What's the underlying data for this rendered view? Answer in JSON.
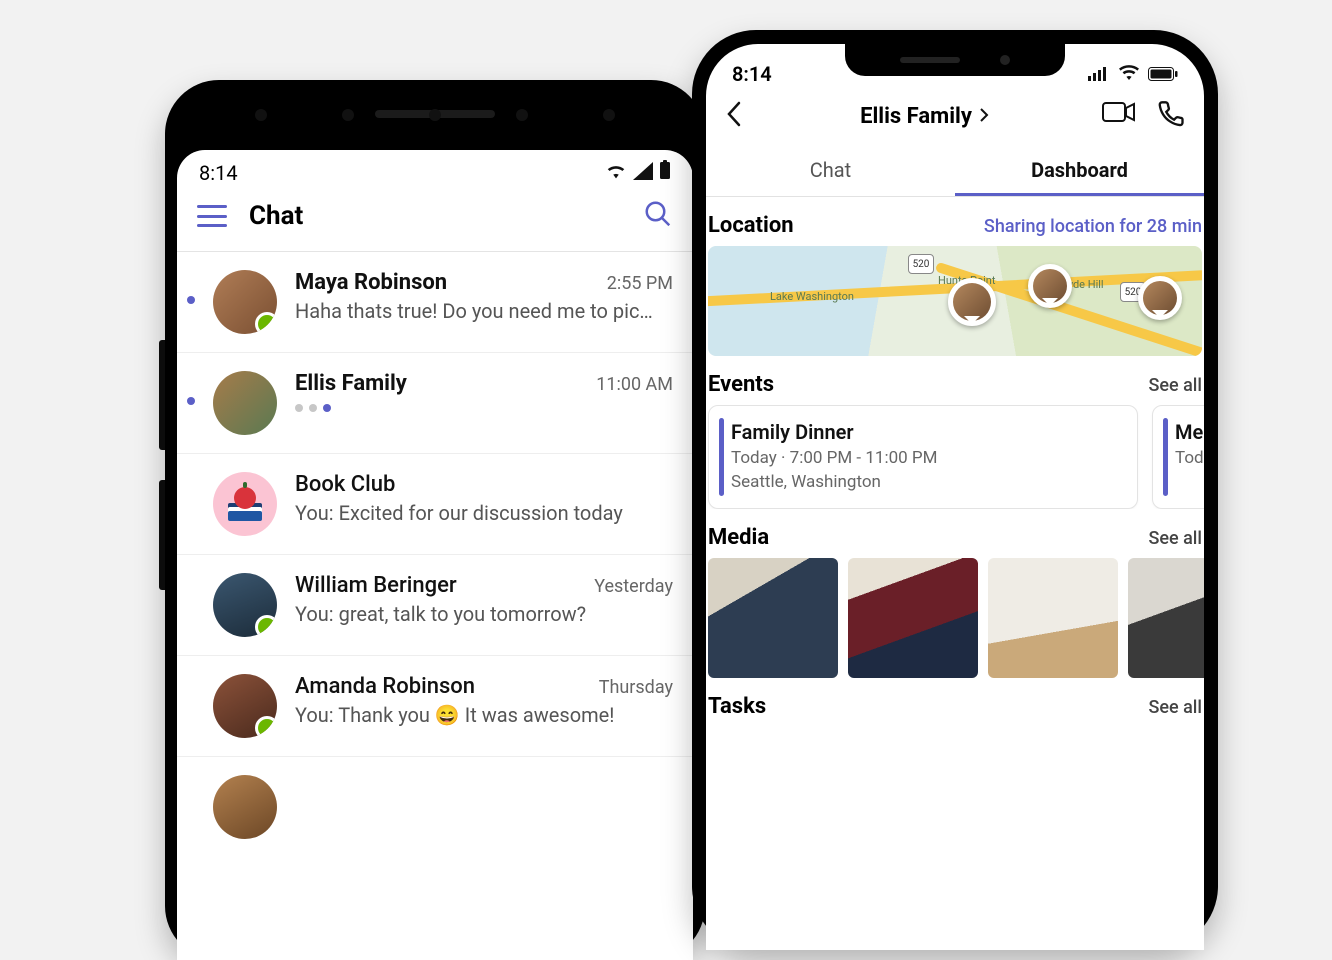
{
  "left_phone": {
    "status": {
      "time": "8:14"
    },
    "header": {
      "title": "Chat"
    },
    "chats": [
      {
        "name": "Maya Robinson",
        "time": "2:55 PM",
        "preview": "Haha thats true! Do you need me to pic…",
        "unread": true,
        "presence": true,
        "typing": false,
        "avatar": "person"
      },
      {
        "name": "Ellis Family",
        "time": "11:00 AM",
        "preview": "",
        "unread": true,
        "presence": false,
        "typing": true,
        "avatar": "horse"
      },
      {
        "name": "Book Club",
        "time": "",
        "preview": "You: Excited for our discussion today",
        "unread": false,
        "presence": false,
        "typing": false,
        "avatar": "bookclub"
      },
      {
        "name": "William Beringer",
        "time": "Yesterday",
        "preview": "You: great, talk to you tomorrow?",
        "unread": false,
        "presence": true,
        "typing": false,
        "avatar": "william"
      },
      {
        "name": "Amanda Robinson",
        "time": "Thursday",
        "preview": "You: Thank you 😄 It was awesome!",
        "unread": false,
        "presence": true,
        "typing": false,
        "avatar": "amanda"
      }
    ]
  },
  "right_phone": {
    "status": {
      "time": "8:14"
    },
    "nav": {
      "title": "Ellis Family"
    },
    "tabs": {
      "chat": "Chat",
      "dashboard": "Dashboard",
      "active": "dashboard"
    },
    "location": {
      "heading": "Location",
      "status_text": "Sharing location for 28 min",
      "map_labels": {
        "lake": "Lake Washington",
        "hunts": "Hunts Point",
        "clyde": "Clyde Hill",
        "route": "520"
      }
    },
    "events": {
      "heading": "Events",
      "see_all": "See all",
      "cards": [
        {
          "title": "Family Dinner",
          "time": "Today · 7:00 PM - 11:00 PM",
          "place": "Seattle, Washington"
        },
        {
          "title": "Me",
          "time": "Tod",
          "place": ""
        }
      ]
    },
    "media": {
      "heading": "Media",
      "see_all": "See all"
    },
    "tasks": {
      "heading": "Tasks",
      "see_all": "See all"
    }
  }
}
